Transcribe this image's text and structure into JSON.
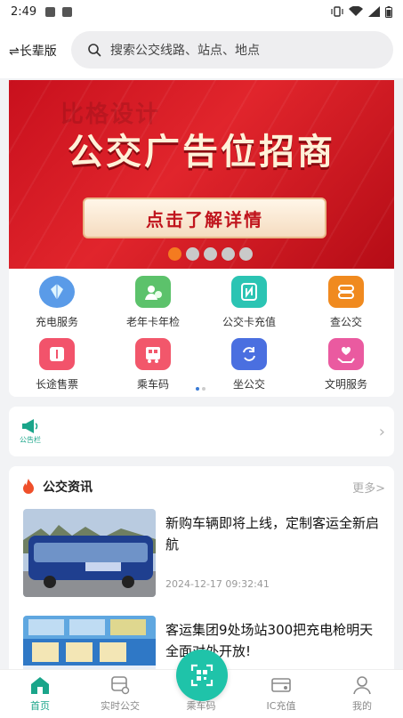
{
  "status_bar": {
    "time": "2:49"
  },
  "header": {
    "mode_toggle": "⇌长辈版",
    "search_placeholder": "搜索公交线路、站点、地点"
  },
  "banner": {
    "watermark": "比格设计",
    "title": "公交广告位招商",
    "cta": "点击了解详情",
    "page_count": 5,
    "active_page": 1
  },
  "services": [
    {
      "label": "充电服务",
      "icon": "charging-icon"
    },
    {
      "label": "老年卡年检",
      "icon": "senior-card-icon"
    },
    {
      "label": "公交卡充值",
      "icon": "nfc-card-icon"
    },
    {
      "label": "查公交",
      "icon": "bus-search-icon"
    },
    {
      "label": "长途售票",
      "icon": "ticket-icon"
    },
    {
      "label": "乘车码",
      "icon": "bus-qr-icon"
    },
    {
      "label": "坐公交",
      "icon": "ride-bus-icon"
    },
    {
      "label": "文明服务",
      "icon": "civility-service-icon"
    }
  ],
  "notice": {
    "label": "公告栏"
  },
  "news": {
    "section_title": "公交资讯",
    "more_label": "更多>",
    "items": [
      {
        "headline": "新购车辆即将上线，定制客运全新启航",
        "date": "2024-12-17 09:32:41"
      },
      {
        "headline": "客运集团9处场站300把充电枪明天全面对外开放!",
        "date": ""
      }
    ]
  },
  "tabbar": {
    "tabs": [
      {
        "label": "首页",
        "active": true
      },
      {
        "label": "实时公交",
        "active": false
      },
      {
        "label": "乘车码",
        "active": false
      },
      {
        "label": "IC充值",
        "active": false
      },
      {
        "label": "我的",
        "active": false
      }
    ]
  },
  "colors": {
    "accent": "#1aa58a",
    "scan_button": "#1fc3a9",
    "banner_red": "#d21b22",
    "dot_active": "#f47b20"
  }
}
